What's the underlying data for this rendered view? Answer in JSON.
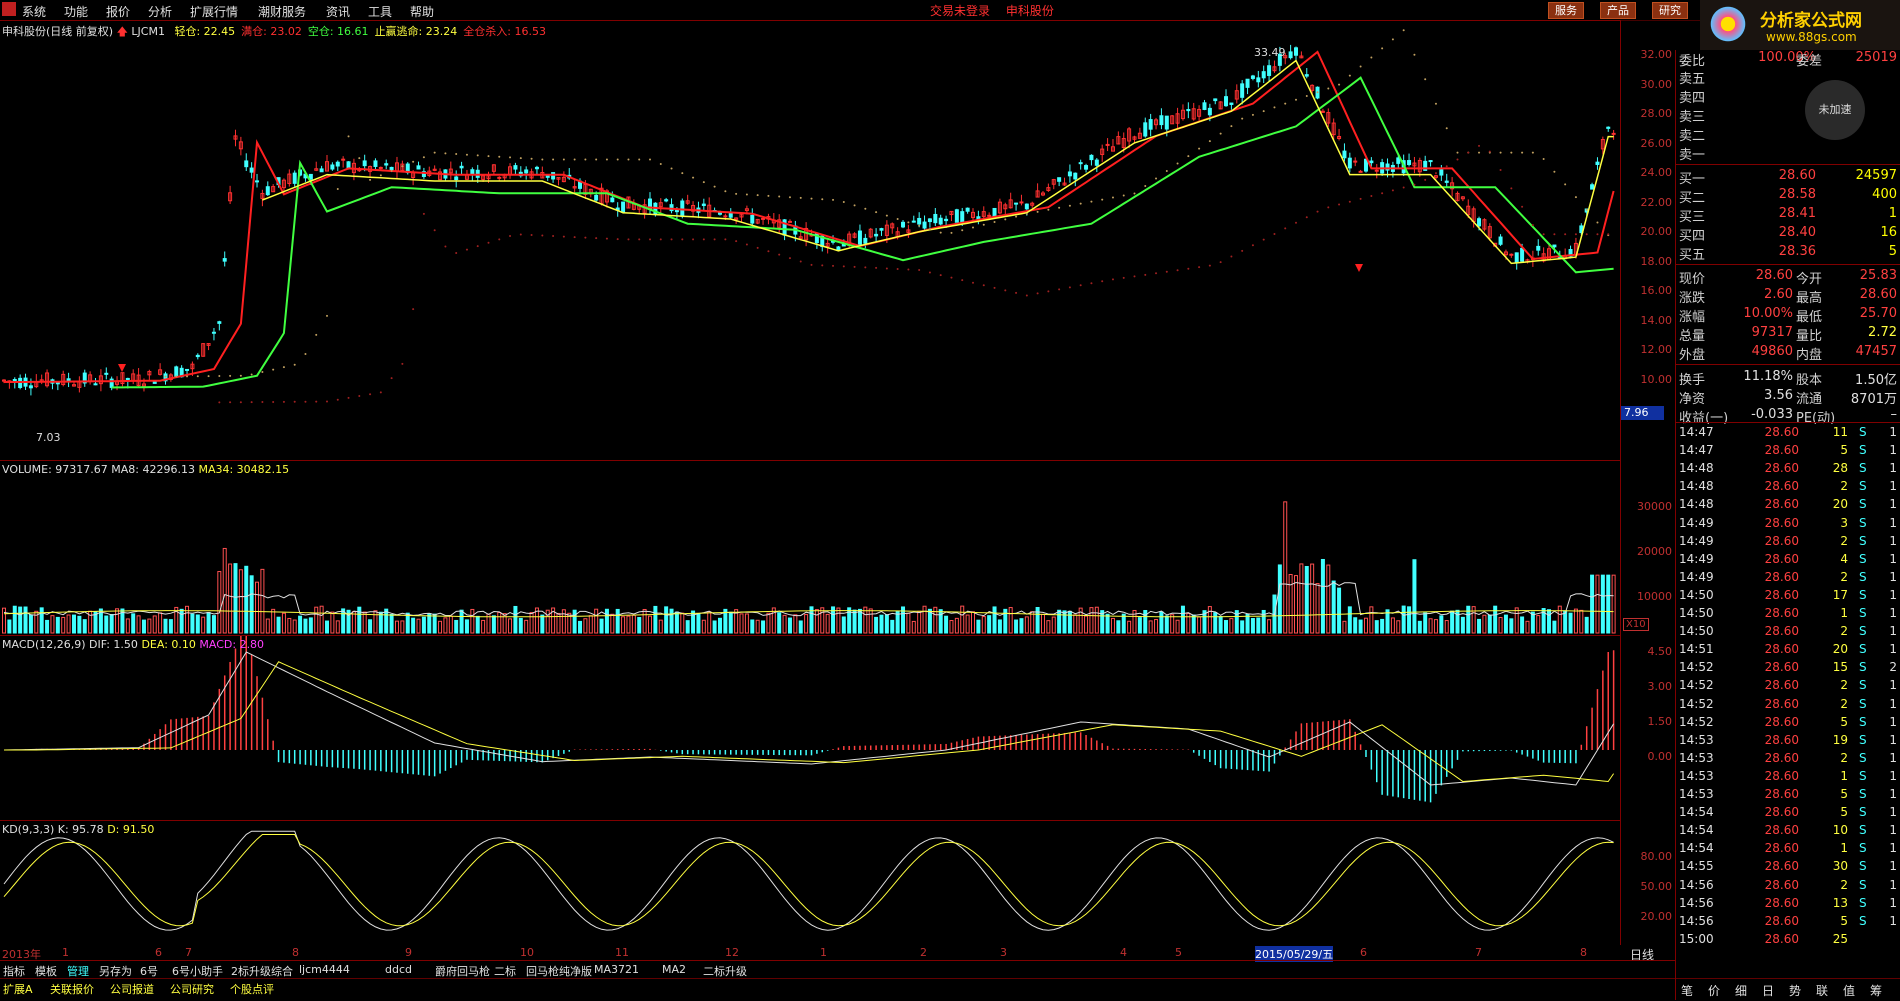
{
  "menu": [
    "系统",
    "功能",
    "报价",
    "分析",
    "扩展行情",
    "潮财服务",
    "资讯",
    "工具",
    "帮助"
  ],
  "center_title": [
    "交易未登录",
    "申科股份"
  ],
  "top_buttons": [
    "服务",
    "产品",
    "研究"
  ],
  "brand": {
    "name": "分析家公式网",
    "url": "www.88gs.com"
  },
  "speed_label": "未加速",
  "price_panel": {
    "title": "申科股份(日线 前复权)",
    "indicator": "LJCM1",
    "items": [
      {
        "label": "轻仓: 22.45",
        "color": "#ffff40"
      },
      {
        "label": "满仓: 23.02",
        "color": "#ff3030"
      },
      {
        "label": "空仓: 16.61",
        "color": "#40ff40"
      },
      {
        "label": "止赢逃命: 23.24",
        "color": "#ffff40"
      },
      {
        "label": "全仓杀入: 16.53",
        "color": "#ff3030"
      }
    ],
    "high_label": "33.49",
    "low_label": "7.03",
    "current_marker": "7.96",
    "yticks": [
      "32.00",
      "30.00",
      "28.00",
      "26.00",
      "24.00",
      "22.00",
      "20.00",
      "18.00",
      "16.00",
      "14.00",
      "12.00",
      "10.00"
    ]
  },
  "volume_panel": {
    "title": "VOLUME: 97317.67",
    "ma8": "MA8: 42296.13",
    "ma34": "MA34: 30482.15",
    "yticks": [
      "30000",
      "20000",
      "10000"
    ],
    "unit": "X10"
  },
  "macd_panel": {
    "title": "MACD(12,26,9)",
    "dif": "DIF: 1.50",
    "dea": "DEA: 0.10",
    "macd": "MACD: 2.80",
    "yticks": [
      "4.50",
      "3.00",
      "1.50",
      "0.00"
    ]
  },
  "kd_panel": {
    "title": "KD(9,3,3)",
    "k": "K: 95.78",
    "d": "D: 91.50",
    "yticks": [
      "80.00",
      "50.00",
      "20.00"
    ]
  },
  "xaxis": {
    "labels": [
      "2013年",
      "1",
      "6",
      "7",
      "8",
      "9",
      "10",
      "11",
      "12",
      "1",
      "2",
      "3",
      "4",
      "5",
      "2015/05/29/五",
      "6",
      "7",
      "8"
    ],
    "period": "日线"
  },
  "bottom_tabs": [
    "指标",
    "模板",
    "管理",
    "另存为",
    "6号",
    "6号小助手",
    "2标升级综合",
    "ljcm4444",
    "ddcd",
    "爵府回马枪",
    "二标",
    "回马枪纯净版",
    "MA3721",
    "MA2",
    "二标升级"
  ],
  "bottom_tabs2": [
    "扩展A",
    "关联报价",
    "公司报道",
    "公司研究",
    "个股点评"
  ],
  "right_tabs": [
    "笔",
    "价",
    "细",
    "日",
    "势",
    "联",
    "值",
    "筹"
  ],
  "orderbook": {
    "header": {
      "label": "委比",
      "pct": "100.00%",
      "label2": "委差",
      "val": "25019"
    },
    "asks": [
      "卖五",
      "卖四",
      "卖三",
      "卖二",
      "卖一"
    ],
    "bids": [
      {
        "label": "买一",
        "price": "28.60",
        "vol": "24597"
      },
      {
        "label": "买二",
        "price": "28.58",
        "vol": "400"
      },
      {
        "label": "买三",
        "price": "28.41",
        "vol": "1"
      },
      {
        "label": "买四",
        "price": "28.40",
        "vol": "16"
      },
      {
        "label": "买五",
        "price": "28.36",
        "vol": "5"
      }
    ]
  },
  "stats": [
    {
      "l1": "现价",
      "v1": "28.60",
      "l2": "今开",
      "v2": "25.83"
    },
    {
      "l1": "涨跌",
      "v1": "2.60",
      "l2": "最高",
      "v2": "28.60"
    },
    {
      "l1": "涨幅",
      "v1": "10.00%",
      "l2": "最低",
      "v2": "25.70"
    },
    {
      "l1": "总量",
      "v1": "97317",
      "l2": "量比",
      "v2": "2.72"
    },
    {
      "l1": "外盘",
      "v1": "49860",
      "l2": "内盘",
      "v2": "47457"
    },
    {
      "l1": "换手",
      "v1": "11.18%",
      "l2": "股本",
      "v2": "1.50亿"
    },
    {
      "l1": "净资",
      "v1": "3.56",
      "l2": "流通",
      "v2": "8701万"
    },
    {
      "l1": "收益(一)",
      "v1": "-0.033",
      "l2": "PE(动)",
      "v2": "–"
    }
  ],
  "trades": [
    [
      "14:47",
      "28.60",
      "11",
      "S",
      "1"
    ],
    [
      "14:47",
      "28.60",
      "5",
      "S",
      "1"
    ],
    [
      "14:48",
      "28.60",
      "28",
      "S",
      "1"
    ],
    [
      "14:48",
      "28.60",
      "2",
      "S",
      "1"
    ],
    [
      "14:48",
      "28.60",
      "20",
      "S",
      "1"
    ],
    [
      "14:49",
      "28.60",
      "3",
      "S",
      "1"
    ],
    [
      "14:49",
      "28.60",
      "2",
      "S",
      "1"
    ],
    [
      "14:49",
      "28.60",
      "4",
      "S",
      "1"
    ],
    [
      "14:49",
      "28.60",
      "2",
      "S",
      "1"
    ],
    [
      "14:50",
      "28.60",
      "17",
      "S",
      "1"
    ],
    [
      "14:50",
      "28.60",
      "1",
      "S",
      "1"
    ],
    [
      "14:50",
      "28.60",
      "2",
      "S",
      "1"
    ],
    [
      "14:51",
      "28.60",
      "20",
      "S",
      "1"
    ],
    [
      "14:52",
      "28.60",
      "15",
      "S",
      "2"
    ],
    [
      "14:52",
      "28.60",
      "2",
      "S",
      "1"
    ],
    [
      "14:52",
      "28.60",
      "2",
      "S",
      "1"
    ],
    [
      "14:52",
      "28.60",
      "5",
      "S",
      "1"
    ],
    [
      "14:53",
      "28.60",
      "19",
      "S",
      "1"
    ],
    [
      "14:53",
      "28.60",
      "2",
      "S",
      "1"
    ],
    [
      "14:53",
      "28.60",
      "1",
      "S",
      "1"
    ],
    [
      "14:53",
      "28.60",
      "5",
      "S",
      "1"
    ],
    [
      "14:54",
      "28.60",
      "5",
      "S",
      "1"
    ],
    [
      "14:54",
      "28.60",
      "10",
      "S",
      "1"
    ],
    [
      "14:54",
      "28.60",
      "1",
      "S",
      "1"
    ],
    [
      "14:55",
      "28.60",
      "30",
      "S",
      "1"
    ],
    [
      "14:56",
      "28.60",
      "2",
      "S",
      "1"
    ],
    [
      "14:56",
      "28.60",
      "13",
      "S",
      "1"
    ],
    [
      "14:56",
      "28.60",
      "5",
      "S",
      "1"
    ],
    [
      "15:00",
      "28.60",
      "25",
      "",
      ""
    ]
  ],
  "colors": {
    "up": "#ff3030",
    "down": "#40ffff",
    "ma_yellow": "#ffff40",
    "green": "#40ff40",
    "axis": "#800000"
  }
}
